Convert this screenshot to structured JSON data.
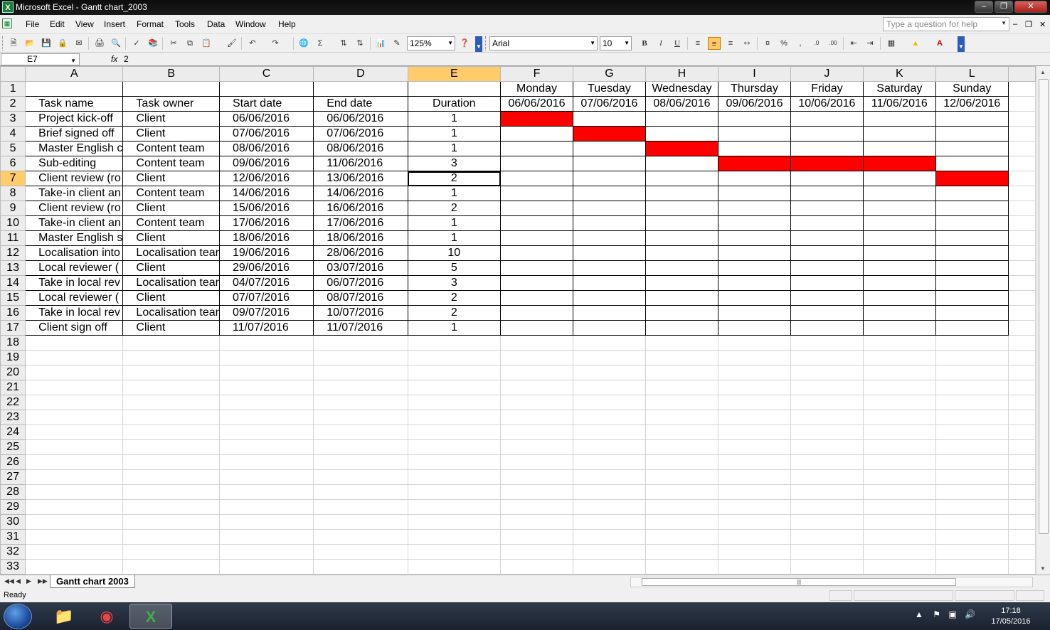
{
  "window": {
    "title": "Microsoft Excel - Gantt chart_2003",
    "app_icon": "excel-icon",
    "controls": [
      "minimize",
      "restore",
      "close"
    ]
  },
  "menu": {
    "items": [
      "File",
      "Edit",
      "View",
      "Insert",
      "Format",
      "Tools",
      "Data",
      "Window",
      "Help"
    ],
    "help_placeholder": "Type a question for help"
  },
  "toolbar": {
    "zoom": "125%",
    "font": "Arial",
    "font_size": "10"
  },
  "formula_bar": {
    "name_box": "E7",
    "fx_label": "fx",
    "formula": "2"
  },
  "columns": [
    "A",
    "B",
    "C",
    "D",
    "E",
    "F",
    "G",
    "H",
    "I",
    "J",
    "K",
    "L"
  ],
  "selected_column": "E",
  "selected_row": 7,
  "gantt_days": [
    "Monday",
    "Tuesday",
    "Wednesday",
    "Thursday",
    "Friday",
    "Saturday",
    "Sunday"
  ],
  "gantt_dates": [
    "06/06/2016",
    "07/06/2016",
    "08/06/2016",
    "09/06/2016",
    "10/06/2016",
    "11/06/2016",
    "12/06/2016"
  ],
  "headers": {
    "task": "Task name",
    "owner": "Task owner",
    "start": "Start date",
    "end": "End date",
    "duration": "Duration"
  },
  "tasks": [
    {
      "name": "Project kick-off",
      "owner": "Client",
      "start": "06/06/2016",
      "end": "06/06/2016",
      "duration": "1",
      "bar_cols": [
        0
      ]
    },
    {
      "name": "Brief signed off",
      "owner": "Client",
      "start": "07/06/2016",
      "end": "07/06/2016",
      "duration": "1",
      "bar_cols": [
        1
      ]
    },
    {
      "name": "Master English c",
      "owner": "Content team",
      "start": "08/06/2016",
      "end": "08/06/2016",
      "duration": "1",
      "bar_cols": [
        2
      ]
    },
    {
      "name": "Sub-editing",
      "owner": "Content team",
      "start": "09/06/2016",
      "end": "11/06/2016",
      "duration": "3",
      "bar_cols": [
        3,
        4,
        5
      ]
    },
    {
      "name": "Client review (ro",
      "owner": "Client",
      "start": "12/06/2016",
      "end": "13/06/2016",
      "duration": "2",
      "bar_cols": [
        6
      ]
    },
    {
      "name": "Take-in client an",
      "owner": "Content team",
      "start": "14/06/2016",
      "end": "14/06/2016",
      "duration": "1",
      "bar_cols": []
    },
    {
      "name": "Client review (ro",
      "owner": "Client",
      "start": "15/06/2016",
      "end": "16/06/2016",
      "duration": "2",
      "bar_cols": []
    },
    {
      "name": "Take-in client an",
      "owner": "Content team",
      "start": "17/06/2016",
      "end": "17/06/2016",
      "duration": "1",
      "bar_cols": []
    },
    {
      "name": "Master English s",
      "owner": "Client",
      "start": "18/06/2016",
      "end": "18/06/2016",
      "duration": "1",
      "bar_cols": []
    },
    {
      "name": "Localisation into",
      "owner": "Localisation tear",
      "start": "19/06/2016",
      "end": "28/06/2016",
      "duration": "10",
      "bar_cols": []
    },
    {
      "name": "Local reviewer (",
      "owner": "Client",
      "start": "29/06/2016",
      "end": "03/07/2016",
      "duration": "5",
      "bar_cols": []
    },
    {
      "name": "Take in local rev",
      "owner": "Localisation tear",
      "start": "04/07/2016",
      "end": "06/07/2016",
      "duration": "3",
      "bar_cols": []
    },
    {
      "name": "Local reviewer (",
      "owner": "Client",
      "start": "07/07/2016",
      "end": "08/07/2016",
      "duration": "2",
      "bar_cols": []
    },
    {
      "name": "Take in local rev",
      "owner": "Localisation tear",
      "start": "09/07/2016",
      "end": "10/07/2016",
      "duration": "2",
      "bar_cols": []
    },
    {
      "name": "Client sign off",
      "owner": "Client",
      "start": "11/07/2016",
      "end": "11/07/2016",
      "duration": "1",
      "bar_cols": []
    }
  ],
  "total_rows": 33,
  "sheet_tab": "Gantt chart 2003",
  "status": "Ready",
  "bar_color": "#ff0000",
  "taskbar": {
    "apps": [
      "file-explorer-icon",
      "chrome-icon",
      "excel-icon"
    ],
    "time": "17:18",
    "date": "17/05/2016"
  }
}
